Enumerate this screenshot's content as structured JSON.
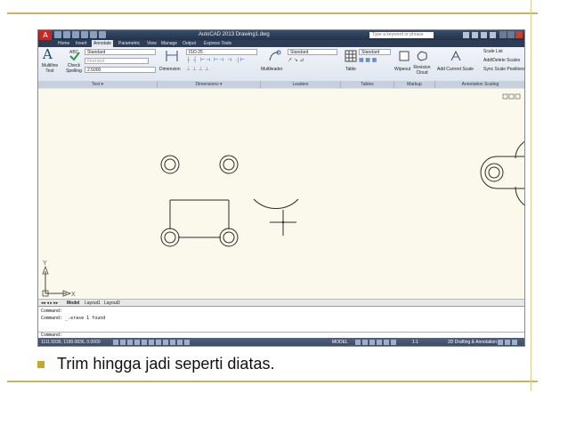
{
  "colors": {
    "slide_rule": "#c9b560",
    "bullet": "#c2a92c",
    "canvas_bg": "#fbf9ec",
    "titlebar": "#2d3d55",
    "cad_line": "#2b2b2b"
  },
  "window": {
    "app_title": "AutoCAD 2013   Drawing1.dwg",
    "search_placeholder": "Type a keyword or phrase"
  },
  "ribbon_tabs": [
    "Home",
    "Insert",
    "Annotate",
    "Parametric",
    "View",
    "Manage",
    "Output",
    "Express Tools"
  ],
  "active_tab": "Annotate",
  "ribbon": {
    "text_panel": {
      "multiline_text": "Multiline Text",
      "check_spelling": "Check Spelling",
      "style_value": "Standard",
      "find_placeholder": "Find text",
      "height_value": "2.5000",
      "panel_label": "Text ▾"
    },
    "dimensions_panel": {
      "dimension_button": "Dimension",
      "style_value": "ISO-25",
      "panel_label": "Dimensions ▾"
    },
    "leaders_panel": {
      "multileader_button": "Multileader",
      "style_value": "Standard",
      "panel_label": "Leaders"
    },
    "tables_panel": {
      "table_button": "Table",
      "style_value": "Standard",
      "panel_label": "Tables"
    },
    "markup_panel": {
      "wipeout_button": "Wipeout",
      "revision_cloud_button": "Revision Cloud",
      "panel_label": "Markup"
    },
    "annotation_scaling_panel": {
      "add_current_scale": "Add Current Scale",
      "scale_list": "Scale List",
      "add_delete_scales": "Add/Delete Scales",
      "sync_scale_positions": "Sync Scale Positions",
      "panel_label": "Annotation Scaling"
    }
  },
  "ucs": {
    "y_label": "Y",
    "x_label": "X"
  },
  "layout_tabs": [
    "Model",
    "Layout1",
    "Layout2"
  ],
  "command_lines": [
    "Command:",
    "Command: _.erase 1 found"
  ],
  "command_prompt": "Command:",
  "status": {
    "coordinates": "1111.5936, 1198.0836, 0.0000",
    "model_label": "MODEL",
    "scale_label": "1:1",
    "workspace": "2D Drafting & Annotation"
  },
  "slide": {
    "bullet_text": "Trim hingga jadi seperti diatas."
  }
}
